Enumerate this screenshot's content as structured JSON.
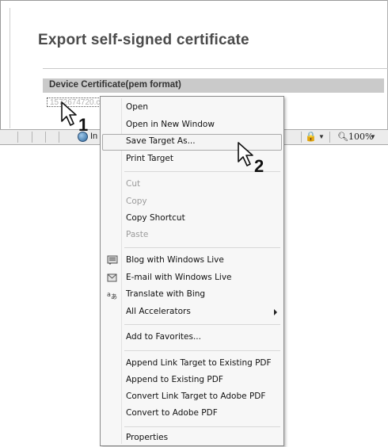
{
  "page": {
    "title": "Export self-signed certificate",
    "cert_section_label": "Device Certificate(pem format)",
    "cert_link_text": "1572674720.cer"
  },
  "statusbar": {
    "zone_text": "In",
    "zoom": "100%"
  },
  "steps": {
    "step1": "1",
    "step2": "2"
  },
  "context_menu": {
    "group1": [
      {
        "label": "Open",
        "enabled": true
      },
      {
        "label": "Open in New Window",
        "enabled": true
      },
      {
        "label": "Save Target As...",
        "enabled": true,
        "highlighted": true
      },
      {
        "label": "Print Target",
        "enabled": true
      }
    ],
    "group2": [
      {
        "label": "Cut",
        "enabled": false
      },
      {
        "label": "Copy",
        "enabled": false
      },
      {
        "label": "Copy Shortcut",
        "enabled": true
      },
      {
        "label": "Paste",
        "enabled": false
      }
    ],
    "group3": [
      {
        "label": "Blog with Windows Live",
        "icon": "blog-icon"
      },
      {
        "label": "E-mail with Windows Live",
        "icon": "email-icon"
      },
      {
        "label": "Translate with Bing",
        "icon": "translate-icon"
      },
      {
        "label": "All Accelerators",
        "has_submenu": true
      }
    ],
    "group4": [
      {
        "label": "Add to Favorites..."
      }
    ],
    "group5": [
      {
        "label": "Append Link Target to Existing PDF"
      },
      {
        "label": "Append to Existing PDF"
      },
      {
        "label": "Convert Link Target to Adobe PDF"
      },
      {
        "label": "Convert to Adobe PDF"
      }
    ],
    "group6": [
      {
        "label": "Properties"
      }
    ]
  }
}
